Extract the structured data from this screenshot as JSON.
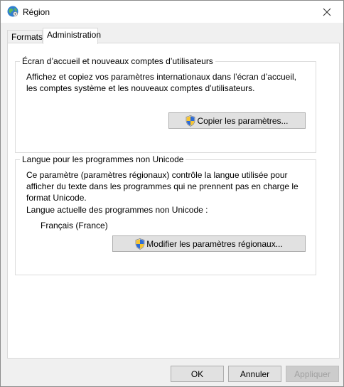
{
  "window": {
    "title": "Région",
    "close_icon": "close-icon",
    "app_icon": "globe-icon"
  },
  "tabs": [
    {
      "label": "Formats",
      "active": false
    },
    {
      "label": "Administration",
      "active": true
    }
  ],
  "welcome_group": {
    "title": "Écran d’accueil et nouveaux comptes d’utilisateurs",
    "line1": "Affichez et copiez vos paramètres internationaux dans l’écran d’accueil,",
    "line2": "les comptes système et les nouveaux comptes d’utilisateurs.",
    "button_label": "Copier les paramètres...",
    "button_icon": "uac-shield-icon"
  },
  "unicode_group": {
    "title": "Langue pour les programmes non Unicode",
    "line1": "Ce paramètre (paramètres régionaux) contrôle la langue utilisée pour",
    "line2": "afficher du texte dans les programmes qui ne prennent pas en charge le",
    "line3": "format Unicode.",
    "current_label": "Langue actuelle des programmes non Unicode :",
    "current_value": "Français (France)",
    "button_label": "Modifier les paramètres régionaux...",
    "button_icon": "uac-shield-icon"
  },
  "footer": {
    "ok_label": "OK",
    "cancel_label": "Annuler",
    "apply_label": "Appliquer",
    "apply_enabled": false
  }
}
